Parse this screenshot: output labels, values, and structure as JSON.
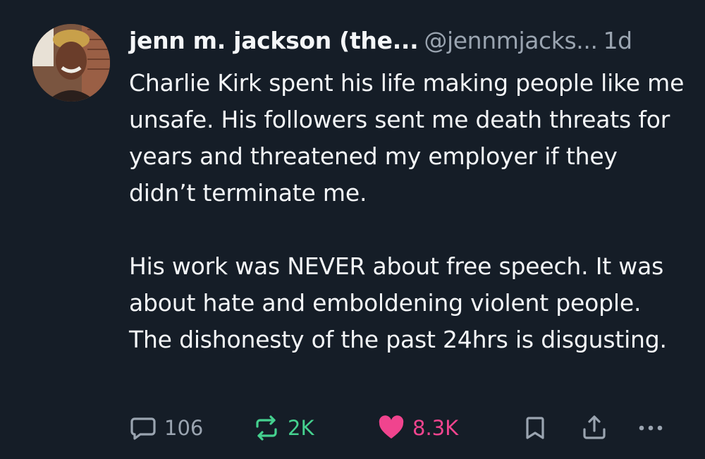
{
  "post": {
    "author": "jenn m. jackson (the...",
    "handle": "@jennmjacks...",
    "time": "1d",
    "paragraphs": [
      "Charlie Kirk spent his life making people like me unsafe. His followers sent me death threats for years and threatened my employer if they didn’t terminate me.",
      "His work was NEVER about free speech. It was about hate and emboldening violent people. The dishonesty of the past 24hrs is disgusting."
    ]
  },
  "actions": {
    "reply": {
      "icon": "speech-bubble-icon",
      "count": "106"
    },
    "repost": {
      "icon": "repost-arrows-icon",
      "count": "2K",
      "color": "#45d18f"
    },
    "like": {
      "icon": "heart-icon",
      "count": "8.3K",
      "color": "#f0448e"
    },
    "bookmark": {
      "icon": "bookmark-icon"
    },
    "share": {
      "icon": "share-icon"
    },
    "more": {
      "icon": "more-dots-icon"
    }
  },
  "colors": {
    "background": "#151d27",
    "text": "#f4f6f8",
    "muted": "#9aa4b0"
  }
}
